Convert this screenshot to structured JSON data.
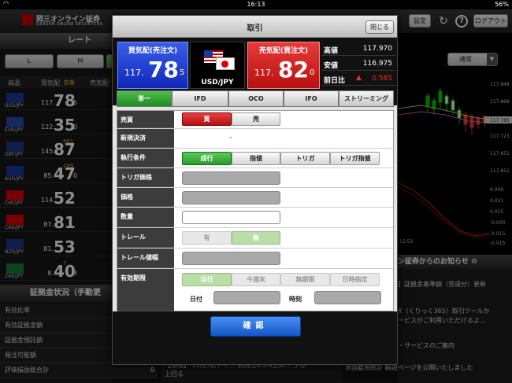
{
  "statusbar": {
    "time": "16:13",
    "battery": "56%"
  },
  "app": {
    "brand_jp": "岡三オンライン証券",
    "brand_en": "OKASAN ONLINE SECURITIES",
    "settings_label": "設定",
    "logout_label": "ログアウト",
    "help_glyph": "?",
    "refresh_glyph": "↻"
  },
  "rate": {
    "title": "レート",
    "lots": [
      "L",
      "M"
    ],
    "col_product": "商品",
    "col_bid": "買気配",
    "col_count": "数量",
    "col_ask": "売気配",
    "rows": [
      {
        "pair": "USD/JPY",
        "pre": "117.",
        "big": "78",
        "small": "5",
        "spread": ""
      },
      {
        "pair": "EUR/JPY",
        "pre": "122.",
        "big": "35",
        "small": "0",
        "spread": ""
      },
      {
        "pair": "GBP/JPY",
        "pre": "145.",
        "big": "87",
        "small": "",
        "spread": "861"
      },
      {
        "pair": "AUD/JPY",
        "pre": "85.",
        "big": "47",
        "small": "0",
        "spread": "499"
      },
      {
        "pair": "CHF/JPY",
        "pre": "114.",
        "big": "52",
        "small": "",
        "spread": ""
      },
      {
        "pair": "CAD/JPY",
        "pre": "87.",
        "big": "81",
        "small": "",
        "spread": ""
      },
      {
        "pair": "NZD/JPY",
        "pre": "81.",
        "big": "53",
        "small": "",
        "spread": ""
      },
      {
        "pair": "ZAR/JPY",
        "pre": "8.",
        "big": "40",
        "small": "3",
        "spread": "7"
      }
    ]
  },
  "margin": {
    "title": "証拠金状況（手動更",
    "rows": [
      {
        "label": "有効比率",
        "value": ""
      },
      {
        "label": "有効証拠金額",
        "value": ""
      },
      {
        "label": "証拠金預託額",
        "value": ""
      },
      {
        "label": "発注可能額",
        "value": ""
      },
      {
        "label": "評価損益総合計",
        "value": "0"
      }
    ]
  },
  "chart": {
    "mode": "通常",
    "y_labels": [
      "117.948",
      "117.868",
      "117.789",
      "117.723",
      "117.651",
      "117.651",
      "0.046",
      "0.031",
      "0.015",
      "-0.000",
      "-0.015",
      "-0.015"
    ],
    "time_label": "15:53",
    "current_price": "117.785"
  },
  "notices": {
    "title": "ン証券からのお知らせ",
    "items": [
      "】証拠金基準額（翌週分）更新",
      "X（くりっく365）取引ツールか",
      "ービスがご利用いただけるよ…",
      "・サービスのご案内"
    ],
    "bottom": "米国雇用統計 解説ページを公開いたしました"
  },
  "ticker": {
    "line1": "【相場】 11月5日ドイ… 前月比0.3%上昇… 予想",
    "line2": "上回る"
  },
  "modal": {
    "title": "取引",
    "close_label": "閉じる",
    "bid_label": "買気配(売注文)",
    "ask_label": "売気配(買注文)",
    "bid_pre": "117.",
    "bid_big": "78",
    "bid_sub": "5",
    "ask_pre": "117.",
    "ask_big": "82",
    "ask_sub": "0",
    "pair": "USD/JPY",
    "high_label": "高値",
    "high_value": "117.970",
    "low_label": "安値",
    "low_value": "116.975",
    "chg_label": "前日比",
    "chg_value": "0.585",
    "tabs": [
      "単一",
      "IFD",
      "OCO",
      "IFO",
      "ストリーミング"
    ],
    "fields": {
      "side_label": "売買",
      "side_buy": "買",
      "side_sell": "売",
      "settle_label": "新規決済",
      "settle_value": "-",
      "cond_label": "執行条件",
      "cond_opts": [
        "成行",
        "指値",
        "トリガ",
        "トリガ指値"
      ],
      "trigger_label": "トリガ価格",
      "price_label": "価格",
      "qty_label": "数量",
      "trail_label": "トレール",
      "trail_on": "有",
      "trail_off": "無",
      "trailw_label": "トレール値幅",
      "exp_label": "有効期限",
      "exp_opts": [
        "当日",
        "今週末",
        "無期限",
        "日時指定"
      ],
      "date_label": "日付",
      "time_label": "時刻"
    },
    "confirm_label": "確認"
  },
  "colors": {
    "accent_green": "#2a9a2a",
    "bid_blue": "#1028b8",
    "ask_red": "#b81010",
    "confirm_blue": "#1456c8"
  }
}
